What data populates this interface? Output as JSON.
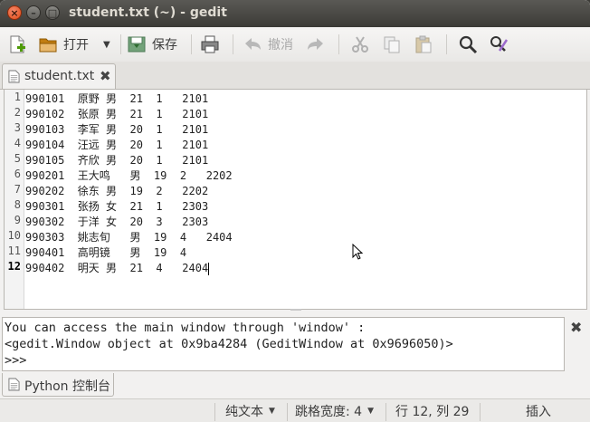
{
  "window": {
    "title": "student.txt (~) - gedit"
  },
  "toolbar": {
    "open_label": "打开",
    "save_label": "保存",
    "undo_label": "撤消"
  },
  "tab": {
    "label": "student.txt"
  },
  "editor": {
    "line_numbers": [
      "1",
      "2",
      "3",
      "4",
      "5",
      "6",
      "7",
      "8",
      "9",
      "10",
      "11",
      "12"
    ],
    "lines": [
      "990101  原野 男  21  1   2101",
      "990102  张原 男  21  1   2101",
      "990103  李军 男  20  1   2101",
      "990104  汪远 男  20  1   2101",
      "990105  齐欣 男  20  1   2101",
      "990201  王大鸣   男  19  2   2202",
      "990202  徐东 男  19  2   2202",
      "990301  张扬 女  21  1   2303",
      "990302  于洋 女  20  3   2303",
      "990303  姚志旬   男  19  4   2404",
      "990401  高明镜   男  19  4",
      "990402  明天 男  21  4   2404"
    ]
  },
  "python_console": {
    "lines": [
      "You can access the main window through 'window' :",
      "<gedit.Window object at 0x9ba4284 (GeditWindow at 0x9696050)>",
      ">>>"
    ],
    "tab_label": "Python 控制台"
  },
  "statusbar": {
    "syntax": "纯文本",
    "tab_width": "跳格宽度: 4",
    "position": "行 12, 列 29",
    "mode": "插入"
  }
}
